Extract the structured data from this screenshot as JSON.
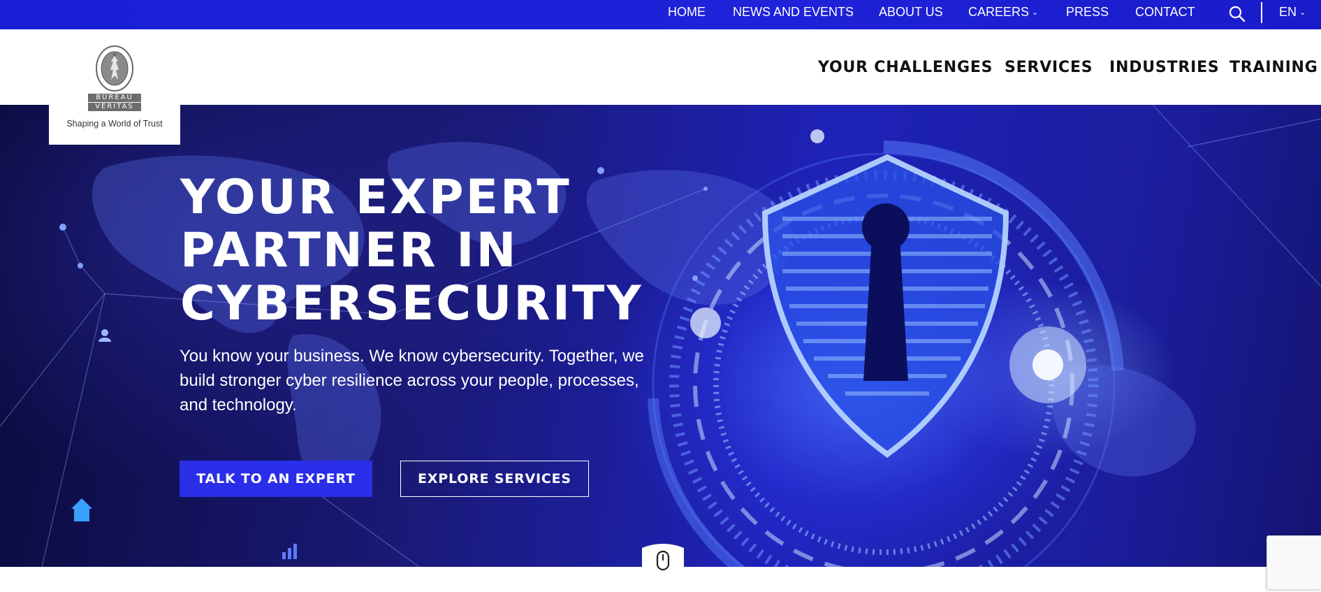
{
  "topbar": {
    "links": [
      "HOME",
      "NEWS AND EVENTS",
      "ABOUT US",
      "CAREERS",
      "PRESS",
      "CONTACT"
    ],
    "language": "EN",
    "search_icon": "search-icon",
    "accent_color": "#1a1fd6"
  },
  "logo": {
    "top_word": "BUREAU",
    "bottom_word": "VERITAS",
    "seal_text": "BUREAU VERITAS 1828",
    "tagline": "Shaping a World of Trust"
  },
  "mainnav": {
    "items": [
      "YOUR CHALLENGES",
      "SERVICES",
      "INDUSTRIES",
      "TRAINING"
    ]
  },
  "hero": {
    "title": "YOUR EXPERT PARTNER IN CYBERSECURITY",
    "subtitle": "You know your business. We know cybersecurity. Together, we build stronger cyber resilience across your people, processes, and technology.",
    "primary_cta": "TALK TO AN EXPERT",
    "secondary_cta": "EXPLORE SERVICES",
    "primary_color": "#2a2ee8",
    "scroll_icon": "mouse-scroll-icon"
  }
}
